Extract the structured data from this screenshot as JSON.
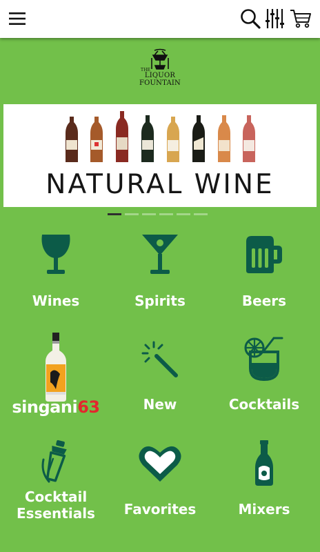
{
  "topbar": {
    "icons": [
      "hamburger-menu-icon",
      "search-icon",
      "filter-sliders-icon",
      "cart-icon"
    ]
  },
  "logo": {
    "line1": "THE",
    "line2": "LIQUOR",
    "line3": "FOUNTAIN"
  },
  "banner": {
    "title": "NATURAL WINE",
    "slide_count": 6,
    "active_slide": 1
  },
  "categories": [
    {
      "label": "Wines",
      "icon": "wine-glass-icon"
    },
    {
      "label": "Spirits",
      "icon": "martini-glass-icon"
    },
    {
      "label": "Beers",
      "icon": "beer-mug-icon"
    },
    {
      "label": "",
      "icon": "singani63-bottle-image",
      "brand": {
        "word": "singani",
        "number": "63"
      }
    },
    {
      "label": "New",
      "icon": "magic-wand-icon"
    },
    {
      "label": "Cocktails",
      "icon": "cocktail-glass-icon"
    },
    {
      "label": "Cocktail Essentials",
      "label_line1": "Cocktail",
      "label_line2": "Essentials",
      "icon": "cocktail-shaker-icon"
    },
    {
      "label": "Favorites",
      "icon": "heart-icon"
    },
    {
      "label": "Mixers",
      "icon": "mixer-bottle-icon"
    }
  ],
  "colors": {
    "background": "#72c04a",
    "icon": "#0c5b48",
    "label": "#ffffff",
    "brand_red": "#e2272d"
  }
}
